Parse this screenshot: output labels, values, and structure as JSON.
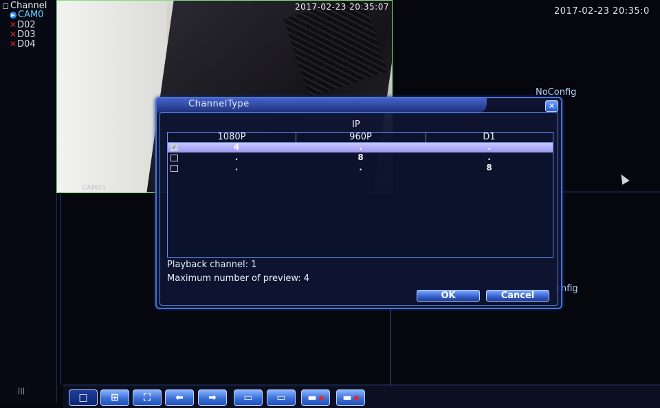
{
  "channel_panel": {
    "title": "Channel",
    "items": [
      {
        "label": "CAM0",
        "status": "active"
      },
      {
        "label": "D02",
        "status": "disconnected"
      },
      {
        "label": "D03",
        "status": "disconnected"
      },
      {
        "label": "D04",
        "status": "disconnected"
      }
    ],
    "bottom_indicator": "|||"
  },
  "video": {
    "cam_timestamp": "2017-02-23 20:35:07",
    "cam_label": "CAM01",
    "system_time": "2017-02-23 20:35:0",
    "noconfig_1": "NoConfig",
    "noconfig_2": "onfig"
  },
  "dialog": {
    "title": "ChannelType",
    "close_glyph": "✕",
    "group_label": "IP",
    "columns": [
      "1080P",
      "960P",
      "D1"
    ],
    "rows": [
      {
        "checked": true,
        "cells": [
          "4",
          ".",
          "."
        ]
      },
      {
        "checked": false,
        "cells": [
          ".",
          "8",
          "."
        ]
      },
      {
        "checked": false,
        "cells": [
          ".",
          ".",
          "8"
        ]
      }
    ],
    "playback_channel": "Playback channel: 1",
    "max_preview": "Maximum number of preview: 4",
    "ok_label": "OK",
    "cancel_label": "Cancel"
  },
  "toolbar": {
    "buttons": [
      {
        "icon": "single-view-icon",
        "glyph": "□"
      },
      {
        "icon": "quad-view-icon",
        "glyph": "⊞"
      },
      {
        "icon": "fullscreen-icon",
        "glyph": "⛶"
      },
      {
        "icon": "arrow-left-icon",
        "glyph": "⬅"
      },
      {
        "icon": "arrow-right-icon",
        "glyph": "➡"
      },
      {
        "icon": "playback-icon",
        "glyph": "▭"
      },
      {
        "icon": "monitor-icon",
        "glyph": "▭"
      },
      {
        "icon": "record-icon",
        "glyph": "▬"
      },
      {
        "icon": "stop-record-icon",
        "glyph": "▬"
      }
    ]
  },
  "colors": {
    "accent": "#3a6fd8",
    "dialog_border": "#4d73d8",
    "selected_row": "#b6b4fa",
    "record": "#e02a2a",
    "camera_border": "#7ee07e"
  }
}
